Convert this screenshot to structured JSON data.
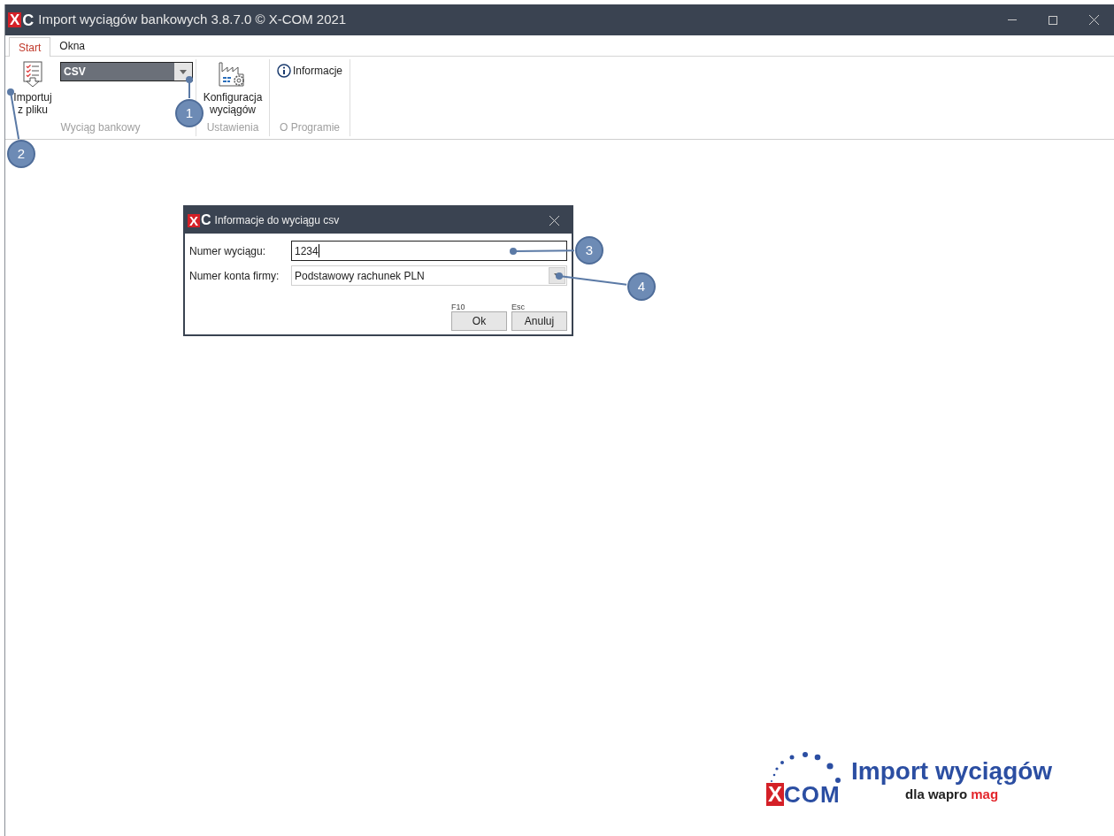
{
  "window": {
    "logo": [
      "X",
      "C"
    ],
    "title": "Import wyciągów bankowych 3.8.7.0 © X-COM 2021"
  },
  "ribbon": {
    "tabs": [
      {
        "label": "Start",
        "selected": true
      },
      {
        "label": "Okna",
        "selected": false
      }
    ],
    "groups": [
      {
        "label": "Wyciąg bankowy",
        "import_button": "Importuj z pliku",
        "format_select": "CSV"
      },
      {
        "label": "Ustawienia",
        "config_button": "Konfiguracja wyciągów"
      },
      {
        "label": "O Programie",
        "info_button": "Informacje"
      }
    ]
  },
  "dialog": {
    "logo": [
      "X",
      "C"
    ],
    "title": "Informacje do wyciągu csv",
    "fields": [
      {
        "kind": "text",
        "label": "Numer wyciągu:",
        "value": "1234",
        "focused": true
      },
      {
        "kind": "select",
        "label": "Numer konta firmy:",
        "value": "Podstawowy rachunek PLN",
        "focused": false
      }
    ],
    "buttons": [
      {
        "shortcut": "F10",
        "label": "Ok"
      },
      {
        "shortcut": "Esc",
        "label": "Anuluj"
      }
    ]
  },
  "callouts": [
    {
      "number": "1"
    },
    {
      "number": "2"
    },
    {
      "number": "3"
    },
    {
      "number": "4"
    }
  ],
  "branding": {
    "logo": [
      "X",
      "COM"
    ],
    "title": "Import wyciągów",
    "subtitle": "dla wapro",
    "subtitle_accent": "mag"
  }
}
